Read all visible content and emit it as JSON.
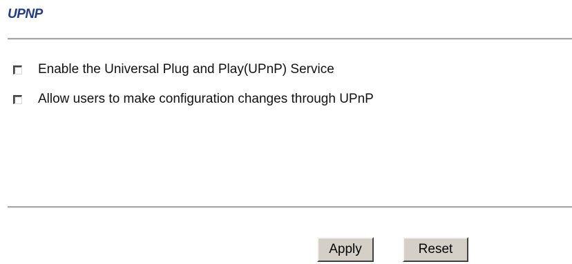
{
  "page": {
    "title": "UPNP"
  },
  "options": [
    {
      "label": "Enable the Universal Plug and Play(UPnP) Service",
      "checked": false
    },
    {
      "label": "Allow users to make configuration changes through UPnP",
      "checked": false
    }
  ],
  "buttons": {
    "apply_label": "Apply",
    "reset_label": "Reset"
  },
  "colors": {
    "title": "#1f3c91",
    "button_face": "#d4d0c8",
    "divider": "#a8a8a8"
  }
}
